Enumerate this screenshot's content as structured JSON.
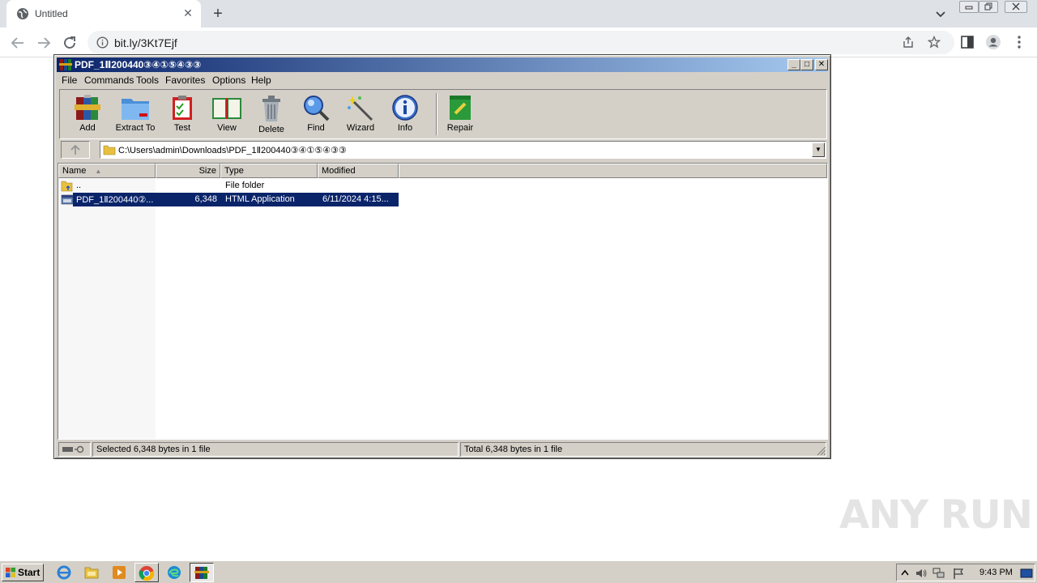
{
  "browser": {
    "tab_title": "Untitled",
    "url": "bit.ly/3Kt7Ejf"
  },
  "winrar": {
    "title": "PDF_1Ⅱ200440③④①⑤④③③",
    "menu": [
      "File",
      "Commands",
      "Tools",
      "Favorites",
      "Options",
      "Help"
    ],
    "tools": [
      {
        "label": "Add",
        "icon": "add-archive-icon"
      },
      {
        "label": "Extract To",
        "icon": "extract-folder-icon"
      },
      {
        "label": "Test",
        "icon": "test-clipboard-icon"
      },
      {
        "label": "View",
        "icon": "view-book-icon"
      },
      {
        "label": "Delete",
        "icon": "trash-can-icon"
      },
      {
        "label": "Find",
        "icon": "magnifier-icon"
      },
      {
        "label": "Wizard",
        "icon": "magic-wand-icon"
      },
      {
        "label": "Info",
        "icon": "info-icon"
      },
      {
        "label": "Repair",
        "icon": "repair-kit-icon"
      }
    ],
    "address": "C:\\Users\\admin\\Downloads\\PDF_1Ⅱ200440③④①⑤④③③",
    "columns": {
      "name": "Name",
      "size": "Size",
      "type": "Type",
      "modified": "Modified"
    },
    "rows": [
      {
        "name": "..",
        "size": "",
        "type": "File folder",
        "modified": ""
      },
      {
        "name": "PDF_1Ⅱ200440②...",
        "size": "6,348",
        "type": "HTML Application",
        "modified": "6/11/2024 4:15..."
      }
    ],
    "status_left": "Selected 6,348 bytes in 1 file",
    "status_right": "Total 6,348 bytes in 1 file"
  },
  "watermark": "ANY RUN",
  "taskbar": {
    "start_label": "Start",
    "clock": "9:43 PM"
  },
  "colors": {
    "titlebar": "#0a246a",
    "selection": "#0a246a",
    "chrome_tabstrip": "#dee1e6"
  }
}
